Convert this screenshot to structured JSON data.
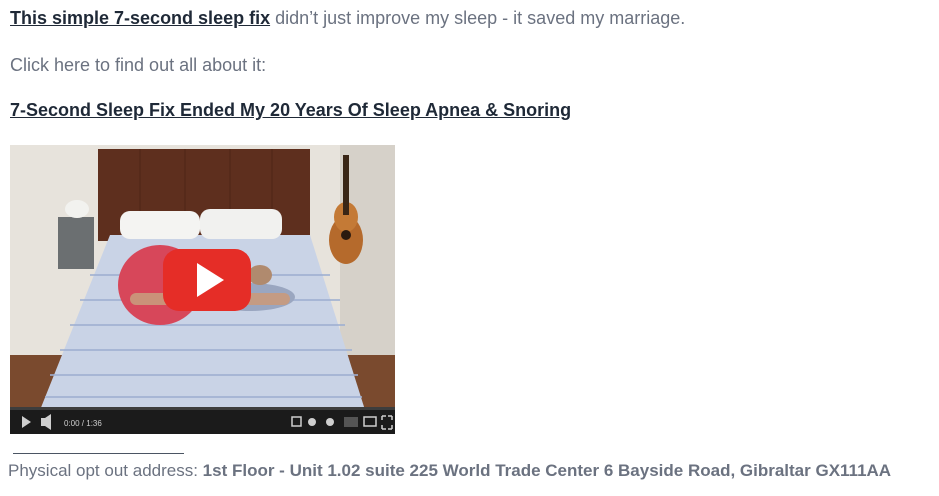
{
  "email": {
    "intro_link": "This simple 7-second sleep fix",
    "intro_text": " didn’t just improve my sleep - it saved my marriage.",
    "cta_text": "Click here to find out all about it:",
    "headline_link": "7-Second Sleep Fix Ended My 20 Years Of Sleep Apnea & Snoring",
    "video": {
      "time_label": "0:00 / 1:36",
      "play_icon": "play-icon",
      "colors": {
        "play_button": "#e52d27",
        "controls_bar": "#1b1b1b"
      }
    },
    "footer": {
      "label": "Physical opt out address: ",
      "address": "1st Floor - Unit 1.02 suite 225 World Trade Center 6 Bayside Road, Gibraltar GX111AA"
    }
  }
}
